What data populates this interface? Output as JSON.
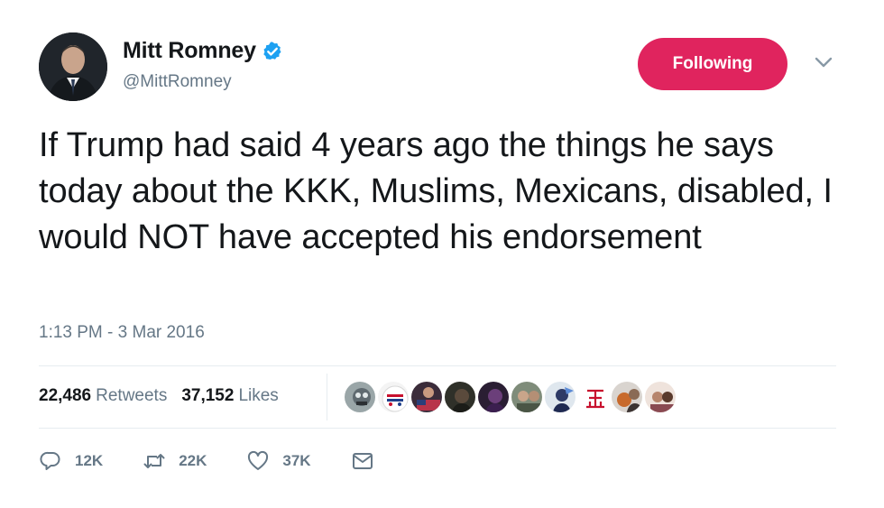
{
  "author": {
    "display_name": "Mitt Romney",
    "handle": "@MittRomney",
    "verified": true
  },
  "follow_button": {
    "label": "Following",
    "color": "#e0245e"
  },
  "tweet": {
    "text": "If Trump had said 4 years ago the things he says today about the KKK, Muslims, Mexicans, disabled, I would NOT have accepted his endorsement",
    "timestamp": "1:13 PM - 3 Mar 2016"
  },
  "stats": {
    "retweets_count": "22,486",
    "retweets_label": "Retweets",
    "likes_count": "37,152",
    "likes_label": "Likes"
  },
  "actions": {
    "reply_count": "12K",
    "retweet_count": "22K",
    "like_count": "37K"
  },
  "icons": {
    "verified": "verified-badge-icon",
    "caret": "chevron-down-icon",
    "reply": "reply-icon",
    "retweet": "retweet-icon",
    "like": "heart-icon",
    "dm": "envelope-icon"
  },
  "colors": {
    "text": "#14171a",
    "muted": "#657786",
    "accent": "#1da1f2",
    "divider": "#e6ecf0"
  }
}
